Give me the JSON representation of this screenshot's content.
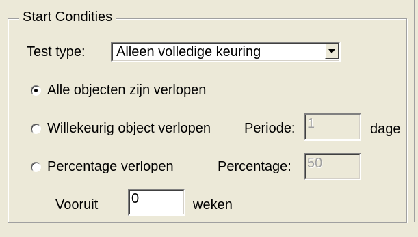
{
  "group": {
    "title": "Start Condities"
  },
  "test_type": {
    "label": "Test type:",
    "selected": "Alleen volledige keuring"
  },
  "options": {
    "all_expired": "Alle objecten zijn verlopen",
    "random_expired": "Willekeurig object verlopen",
    "percentage_expired": "Percentage verlopen"
  },
  "periode": {
    "label": "Periode:",
    "value": "1",
    "unit": "dage"
  },
  "percentage": {
    "label": "Percentage:",
    "value": "50"
  },
  "vooruit": {
    "label": "Vooruit",
    "value": "0",
    "unit": "weken"
  },
  "selected_option": "all_expired"
}
